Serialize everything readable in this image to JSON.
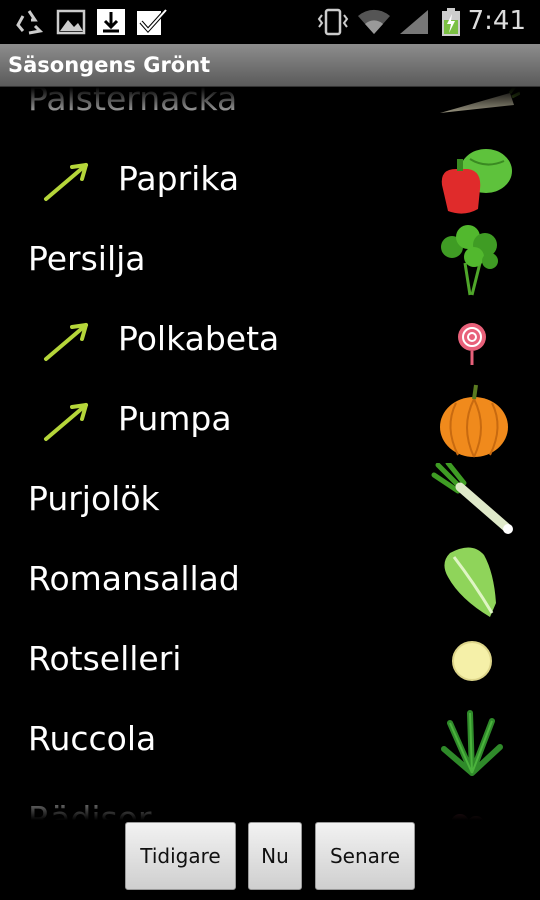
{
  "status_bar": {
    "time": "7:41",
    "icons": [
      "recycle-icon",
      "image-icon",
      "download-icon",
      "checkmark-icon",
      "vibrate-icon",
      "wifi-icon",
      "signal-icon",
      "battery-charging-icon"
    ]
  },
  "app": {
    "title": "Säsongens Grönt"
  },
  "list": {
    "items": [
      {
        "label": "Palsternacka",
        "indent": false,
        "arrow": false,
        "icon": "parsnip-icon"
      },
      {
        "label": "Paprika",
        "indent": true,
        "arrow": true,
        "icon": "pepper-icon"
      },
      {
        "label": "Persilja",
        "indent": false,
        "arrow": false,
        "icon": "parsley-icon"
      },
      {
        "label": "Polkabeta",
        "indent": true,
        "arrow": true,
        "icon": "beet-icon"
      },
      {
        "label": "Pumpa",
        "indent": true,
        "arrow": true,
        "icon": "pumpkin-icon"
      },
      {
        "label": "Purjolök",
        "indent": false,
        "arrow": false,
        "icon": "leek-icon"
      },
      {
        "label": "Romansallad",
        "indent": false,
        "arrow": false,
        "icon": "lettuce-icon"
      },
      {
        "label": "Rotselleri",
        "indent": false,
        "arrow": false,
        "icon": "celeriac-icon"
      },
      {
        "label": "Ruccola",
        "indent": false,
        "arrow": false,
        "icon": "arugula-icon"
      },
      {
        "label": "Rädisor",
        "indent": false,
        "arrow": false,
        "icon": "radish-icon"
      }
    ]
  },
  "buttons": {
    "earlier": "Tidigare",
    "now": "Nu",
    "later": "Senare"
  },
  "colors": {
    "arrow": "#b5d63a",
    "titlebar": "#707070",
    "background": "#000000"
  }
}
